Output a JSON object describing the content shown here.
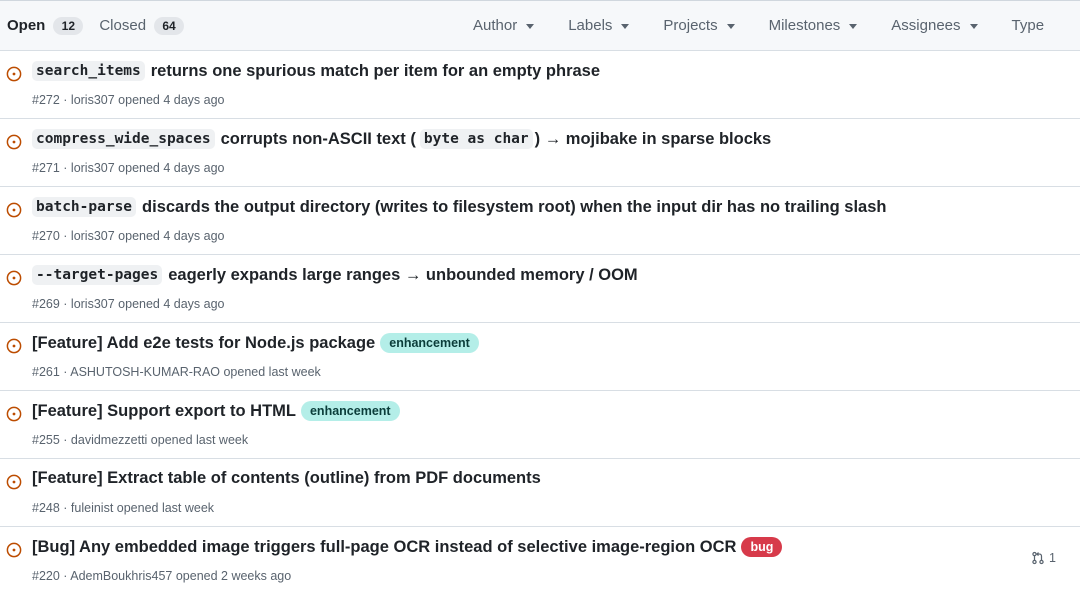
{
  "tabs": {
    "open_label": "Open",
    "open_count": "12",
    "closed_label": "Closed",
    "closed_count": "64"
  },
  "filters": [
    "Author",
    "Labels",
    "Projects",
    "Milestones",
    "Assignees",
    "Type"
  ],
  "colors": {
    "open_icon": "#bc4c00",
    "enhancement_label": "#b4eee8",
    "bug_label": "#d73a4a"
  },
  "issues": [
    {
      "title_code": "search_items",
      "title": "returns one spurious match per item for an empty phrase",
      "meta": "#272 · loris307 opened 4 days ago"
    },
    {
      "title_code": "compress_wide_spaces",
      "title": "corrupts non-ASCII text (",
      "title_code2": "byte as char",
      "title_after": ") → mojibake in sparse blocks",
      "meta": "#271 · loris307 opened 4 days ago"
    },
    {
      "title_code": "batch-parse",
      "title": "discards the output directory (writes to filesystem root) when the input dir has no trailing slash",
      "meta": "#270 · loris307 opened 4 days ago"
    },
    {
      "title_code": "--target-pages",
      "title": "eagerly expands large ranges → unbounded memory / OOM",
      "meta": "#269 · loris307 opened 4 days ago"
    },
    {
      "title": "[Feature] Add e2e tests for Node.js package",
      "label": "enhancement",
      "meta": "#261 · ASHUTOSH-KUMAR-RAO opened last week"
    },
    {
      "title": "[Feature] Support export to HTML",
      "label": "enhancement",
      "meta": "#255 · davidmezzetti opened last week"
    },
    {
      "title": "[Feature] Extract table of contents (outline) from PDF documents",
      "meta": "#248 · fuleinist opened last week"
    },
    {
      "title": "[Bug] Any embedded image triggers full-page OCR instead of selective image-region OCR",
      "label": "bug",
      "meta": "#220 · AdemBoukhris457 opened 2 weeks ago",
      "pr_count": "1"
    }
  ]
}
